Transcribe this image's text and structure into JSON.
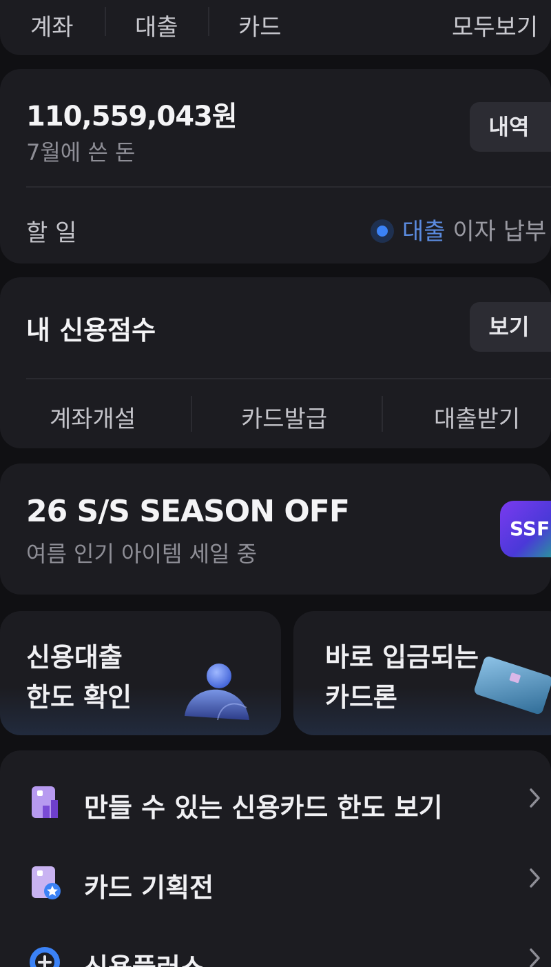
{
  "tabs": [
    {
      "label": "계좌"
    },
    {
      "label": "대출"
    },
    {
      "label": "카드"
    }
  ],
  "view_all_label": "모두보기",
  "spending": {
    "amount": "110,559,043원",
    "subtitle": "7월에 쓴 돈",
    "history_button": "내역",
    "todo_label": "할 일",
    "todo_highlight": "대출",
    "todo_rest": " 이자 납부"
  },
  "credit": {
    "title": "내 신용점수",
    "view_button": "보기",
    "actions": [
      {
        "label": "계좌개설"
      },
      {
        "label": "카드발급"
      },
      {
        "label": "대출받기"
      }
    ]
  },
  "ad": {
    "title": "26 S/S SEASON OFF",
    "subtitle": "여름 인기 아이템 세일 중",
    "logo_text": "SSF"
  },
  "tiles": [
    {
      "line1": "신용대출",
      "line2": "한도 확인",
      "icon": "person-icon"
    },
    {
      "line1": "바로 입금되는",
      "line2": "카드론",
      "icon": "credit-card-icon"
    }
  ],
  "list": [
    {
      "label": "만들 수 있는 신용카드 한도 보기",
      "icon": "card-limit-icon"
    },
    {
      "label": "카드 기획전",
      "icon": "card-star-icon"
    },
    {
      "label": "신용플러스",
      "icon": "plus-circle-icon"
    }
  ],
  "colors": {
    "background": "#101013",
    "card": "#1C1C21",
    "accent_blue": "#3B82F6",
    "icon_purple": "#B79AF0"
  }
}
